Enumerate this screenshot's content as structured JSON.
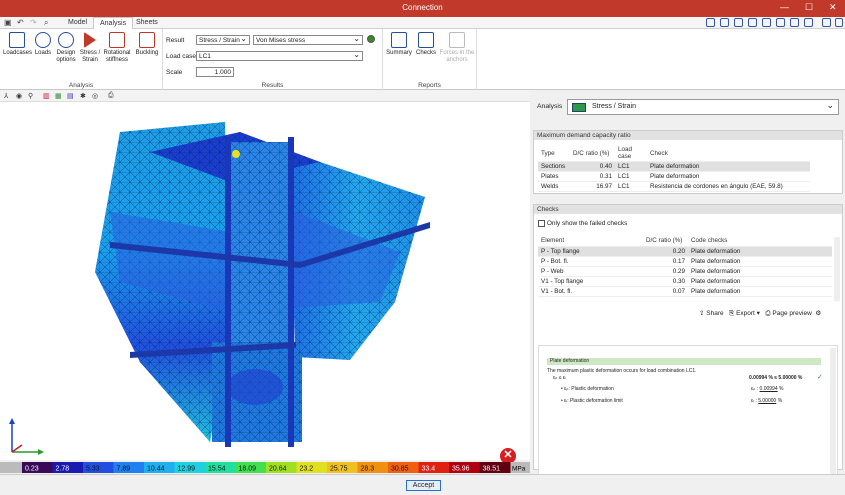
{
  "window": {
    "title": "Connection"
  },
  "menu": {
    "tabs": [
      "Model",
      "Analysis",
      "Sheets"
    ],
    "active": "Analysis"
  },
  "ribbon": {
    "analysis_group": {
      "label": "Analysis",
      "buttons": [
        {
          "label": "Loadcases",
          "icon": "loadcases-icon"
        },
        {
          "label": "Loads",
          "icon": "loads-icon"
        },
        {
          "label": "Design options",
          "icon": "gear-icon"
        },
        {
          "label": "Stress / Strain",
          "icon": "play-icon"
        },
        {
          "label": "Rotational stiffness",
          "icon": "stiffness-icon"
        },
        {
          "label": "Buckling",
          "icon": "buckling-icon"
        }
      ]
    },
    "results_group": {
      "label": "Results",
      "result_label": "Result",
      "result_value": "Stress / Strain",
      "result_type_value": "Von Mises stress",
      "loadcase_label": "Load case",
      "loadcase_value": "LC1",
      "scale_label": "Scale",
      "scale_value": "1.000"
    },
    "reports_group": {
      "label": "Reports",
      "buttons": [
        {
          "label": "Summary",
          "icon": "summary-icon",
          "enabled": true
        },
        {
          "label": "Checks",
          "icon": "checks-icon",
          "enabled": true
        },
        {
          "label": "Forces in the anchors",
          "icon": "anchors-icon",
          "enabled": false
        }
      ]
    }
  },
  "scale": {
    "unit": "MPa",
    "ticks": [
      "0.23",
      "2.78",
      "5.33",
      "7.89",
      "10.44",
      "12.99",
      "15.54",
      "18.09",
      "20.64",
      "23.2",
      "25.75",
      "28.3",
      "30.85",
      "33.4",
      "35.96",
      "38.51"
    ],
    "colors": [
      "#3a0a5a",
      "#1a1ab0",
      "#1e4fe0",
      "#2080f0",
      "#20b0f0",
      "#20d0e0",
      "#20e0a0",
      "#40e050",
      "#a0e020",
      "#e0e020",
      "#f0c020",
      "#f09010",
      "#f06010",
      "#e02010",
      "#b00010",
      "#600010"
    ]
  },
  "analysis_panel": {
    "label": "Analysis",
    "value": "Stress / Strain"
  },
  "dcr": {
    "title": "Maximum demand capacity ratio",
    "headers": [
      "Type",
      "D/C ratio (%)",
      "Load case",
      "Check"
    ],
    "rows": [
      [
        "Sections",
        "0.40",
        "LC1",
        "Plate deformation"
      ],
      [
        "Plates",
        "0.31",
        "LC1",
        "Plate deformation"
      ],
      [
        "Welds",
        "16.97",
        "LC1",
        "Resistencia de cordones en ángulo (EAE, 59.8)"
      ]
    ]
  },
  "checks": {
    "title": "Checks",
    "only_failed_label": "Only show the failed checks",
    "headers": [
      "Element",
      "D/C ratio (%)",
      "Code checks"
    ],
    "rows": [
      [
        "P - Top flange",
        "0.20",
        "Plate deformation"
      ],
      [
        "P - Bot. fl.",
        "0.17",
        "Plate deformation"
      ],
      [
        "P - Web",
        "0.29",
        "Plate deformation"
      ],
      [
        "V1 - Top flange",
        "0.30",
        "Plate deformation"
      ],
      [
        "V1 - Bot. fl.",
        "0.07",
        "Plate deformation"
      ]
    ],
    "actions": [
      "Share",
      "Export",
      "Page preview"
    ]
  },
  "report": {
    "heading": "Plate deformation",
    "sentence": "The maximum plastic deformation occurs for load combination LC1.",
    "check_symbol": "εₚ ≤ εₗ",
    "check_value": "0.00994 % ≤ 5.00000 %",
    "plastic_label": "Plastic deformation",
    "plastic_symbol": "εₚ",
    "plastic_value": "0.00994",
    "limit_label": "Plastic deformation limit",
    "limit_symbol": "εₗ",
    "limit_value": "5.00000",
    "unit": "%"
  },
  "footer": {
    "accept": "Accept"
  }
}
